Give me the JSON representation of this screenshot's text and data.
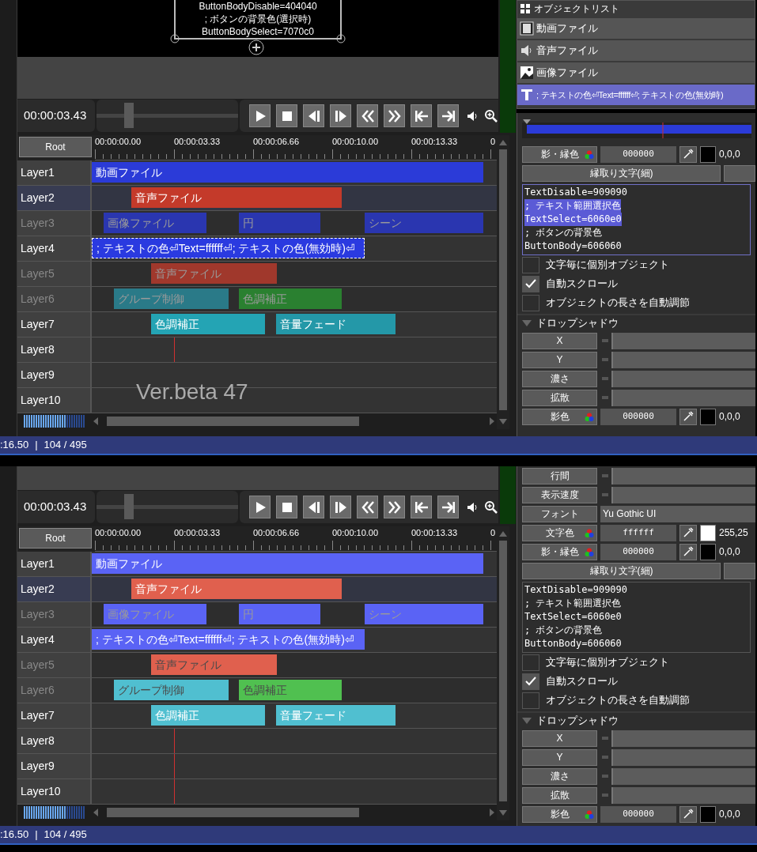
{
  "screens": [
    {
      "preview": {
        "lines": [
          "ButtonBodyDisable=404040",
          "; ボタンの背景色(選択時)",
          "ButtonBodySelect=7070c0"
        ]
      },
      "transport": {
        "time": "00:00:03.43",
        "seek": {
          "level": 0.2
        }
      },
      "timeline": {
        "root": "Root",
        "ruler": [
          "00:00:00.00",
          "00:00:03.33",
          "00:00:06.66",
          "00:00:10.00",
          "00:00:13.33",
          "0"
        ],
        "overlay_text": "Ver.beta 47",
        "layers": [
          {
            "name": "Layer1",
            "enabled": true,
            "selected": false,
            "clips": [
              {
                "label": "動画ファイル",
                "color": "#2b3bd8",
                "selected": false
              }
            ]
          },
          {
            "name": "Layer2",
            "enabled": true,
            "selected": true,
            "clips": [
              {
                "label": "音声ファイル",
                "color": "#c43a2a",
                "selected": false
              }
            ]
          },
          {
            "name": "Layer3",
            "enabled": false,
            "selected": false,
            "clips": [
              {
                "label": "画像ファイル",
                "color": "#2a36b0",
                "selected": false
              },
              {
                "label": "円",
                "color": "#2a36b0",
                "selected": false
              },
              {
                "label": "シーン",
                "color": "#2a36b0",
                "selected": false
              }
            ]
          },
          {
            "name": "Layer4",
            "enabled": true,
            "selected": false,
            "clips": [
              {
                "label": "; テキストの色⏎Text=ffffff⏎; テキストの色(無効時)⏎",
                "color": "#2a3ae0",
                "selected": true
              }
            ]
          },
          {
            "name": "Layer5",
            "enabled": false,
            "selected": false,
            "clips": [
              {
                "label": "音声ファイル",
                "color": "#a0382c",
                "selected": false
              }
            ]
          },
          {
            "name": "Layer6",
            "enabled": false,
            "selected": false,
            "clips": [
              {
                "label": "グループ制御",
                "color": "#2a7a88",
                "selected": false
              },
              {
                "label": "色調補正",
                "color": "#2a8030",
                "selected": false
              }
            ]
          },
          {
            "name": "Layer7",
            "enabled": true,
            "selected": false,
            "clips": [
              {
                "label": "色調補正",
                "color": "#24a4b4",
                "selected": false
              },
              {
                "label": "音量フェード",
                "color": "#2498a8",
                "selected": false
              }
            ]
          },
          {
            "name": "Layer8",
            "enabled": true,
            "selected": false
          },
          {
            "name": "Layer9",
            "enabled": true,
            "selected": false
          },
          {
            "name": "Layer10",
            "enabled": true,
            "selected": false
          }
        ]
      },
      "object_list": {
        "title": "オブジェクトリスト",
        "items": [
          {
            "kind": "video",
            "label": "動画ファイル",
            "selected": false
          },
          {
            "kind": "audio",
            "label": "音声ファイル",
            "selected": false
          },
          {
            "kind": "image",
            "label": "画像ファイル",
            "selected": false
          },
          {
            "kind": "text",
            "label": "; テキストの色⏎Text=ffffff⏎; テキストの色(無効時)",
            "selected": true
          }
        ]
      },
      "properties": {
        "rows": [
          {
            "kind": "color",
            "label": "影・縁色",
            "value": "000000",
            "rgb": "0,0,0",
            "color": "#000000"
          },
          {
            "kind": "button",
            "label": "縁取り文字(細)"
          }
        ],
        "text_focused": true,
        "text_lines": [
          {
            "text": "TextDisable=909090",
            "selected": false
          },
          {
            "text": "; テキスト範囲選択色",
            "selected": true
          },
          {
            "text": "TextSelect=6060e0",
            "selected": true
          },
          {
            "text": "; ボタンの背景色",
            "selected": false
          },
          {
            "text": "ButtonBody=606060",
            "selected": false
          }
        ],
        "checkboxes": [
          {
            "label": "文字毎に個別オブジェクト",
            "checked": false
          },
          {
            "label": "自動スクロール",
            "checked": true
          },
          {
            "label": "オブジェクトの長さを自動調節",
            "checked": false
          }
        ],
        "section": {
          "title": "ドロップシャドウ",
          "expanded": true,
          "rows": [
            {
              "kind": "slider",
              "label": "X"
            },
            {
              "kind": "slider",
              "label": "Y"
            },
            {
              "kind": "slider",
              "label": "濃さ"
            },
            {
              "kind": "slider",
              "label": "拡散"
            },
            {
              "kind": "color",
              "label": "影色",
              "value": "000000",
              "rgb": "0,0,0",
              "color": "#000000"
            }
          ]
        }
      },
      "status_bar": {
        "time": ":16.50",
        "separator": "|",
        "frames": "104 / 495"
      }
    },
    {
      "transport": {
        "time": "00:00:03.43",
        "seek": {
          "level": 0.2
        }
      },
      "timeline": {
        "root": "Root",
        "ruler": [
          "00:00:00.00",
          "00:00:03.33",
          "00:00:06.66",
          "00:00:10.00",
          "00:00:13.33",
          "0"
        ],
        "layers": [
          {
            "name": "Layer1",
            "enabled": true,
            "selected": false,
            "clips": [
              {
                "label": "動画ファイル",
                "color": "#5a63f5",
                "selected": false
              }
            ]
          },
          {
            "name": "Layer2",
            "enabled": true,
            "selected": true,
            "clips": [
              {
                "label": "音声ファイル",
                "color": "#e0604e",
                "selected": false
              }
            ]
          },
          {
            "name": "Layer3",
            "enabled": false,
            "selected": false,
            "clips": [
              {
                "label": "画像ファイル",
                "color": "#5a63f5",
                "selected": false
              },
              {
                "label": "円",
                "color": "#5a63f5",
                "selected": false
              },
              {
                "label": "シーン",
                "color": "#5a63f5",
                "selected": false
              }
            ]
          },
          {
            "name": "Layer4",
            "enabled": true,
            "selected": false,
            "clips": [
              {
                "label": "; テキストの色⏎Text=ffffff⏎; テキストの色(無効時)⏎",
                "color": "#5a63f5",
                "selected": false
              }
            ]
          },
          {
            "name": "Layer5",
            "enabled": false,
            "selected": false,
            "clips": [
              {
                "label": "音声ファイル",
                "color": "#e0604e",
                "selected": false
              }
            ]
          },
          {
            "name": "Layer6",
            "enabled": false,
            "selected": false,
            "clips": [
              {
                "label": "グループ制御",
                "color": "#50bfd0",
                "selected": false
              },
              {
                "label": "色調補正",
                "color": "#50c050",
                "selected": false
              }
            ]
          },
          {
            "name": "Layer7",
            "enabled": true,
            "selected": false,
            "clips": [
              {
                "label": "色調補正",
                "color": "#50bfd0",
                "selected": false
              },
              {
                "label": "音量フェード",
                "color": "#50bfd0",
                "selected": false
              }
            ]
          },
          {
            "name": "Layer8",
            "enabled": true,
            "selected": false
          },
          {
            "name": "Layer9",
            "enabled": true,
            "selected": false
          },
          {
            "name": "Layer10",
            "enabled": true,
            "selected": false
          }
        ]
      },
      "properties": {
        "rows": [
          {
            "kind": "slider",
            "label": "行間"
          },
          {
            "kind": "slider",
            "label": "表示速度"
          },
          {
            "kind": "font",
            "label": "フォント",
            "value": "Yu Gothic UI"
          },
          {
            "kind": "color",
            "label": "文字色",
            "value": "ffffff",
            "rgb": "255,25",
            "color": "#ffffff"
          },
          {
            "kind": "color",
            "label": "影・縁色",
            "value": "000000",
            "rgb": "0,0,0",
            "color": "#000000"
          },
          {
            "kind": "button",
            "label": "縁取り文字(細)"
          }
        ],
        "text_focused": false,
        "text_lines": [
          {
            "text": "TextDisable=909090",
            "selected": false
          },
          {
            "text": "; テキスト範囲選択色",
            "selected": false
          },
          {
            "text": "TextSelect=6060e0",
            "selected": false
          },
          {
            "text": "; ボタンの背景色",
            "selected": false
          },
          {
            "text": "ButtonBody=606060",
            "selected": false
          }
        ],
        "checkboxes": [
          {
            "label": "文字毎に個別オブジェクト",
            "checked": false
          },
          {
            "label": "自動スクロール",
            "checked": true
          },
          {
            "label": "オブジェクトの長さを自動調節",
            "checked": false
          }
        ],
        "section": {
          "title": "ドロップシャドウ",
          "expanded": true,
          "rows": [
            {
              "kind": "slider",
              "label": "X"
            },
            {
              "kind": "slider",
              "label": "Y"
            },
            {
              "kind": "slider",
              "label": "濃さ"
            },
            {
              "kind": "slider",
              "label": "拡散"
            },
            {
              "kind": "color",
              "label": "影色",
              "value": "000000",
              "rgb": "0,0,0",
              "color": "#000000"
            }
          ]
        }
      },
      "status_bar": {
        "time": ":16.50",
        "separator": "|",
        "frames": "104 / 495"
      }
    }
  ]
}
